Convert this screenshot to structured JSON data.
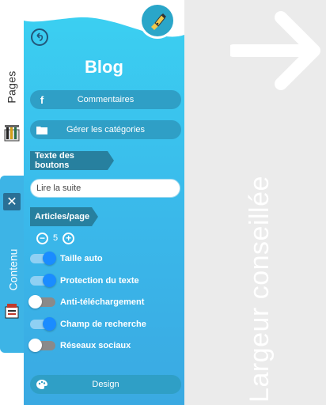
{
  "sidebar": {
    "tabs": {
      "pages": "Pages",
      "contenu": "Contenu"
    }
  },
  "panel": {
    "title": "Blog",
    "buttons": {
      "commentaires": "Commentaires",
      "categories": "Gérer les catégories",
      "design": "Design"
    },
    "sections": {
      "texte_boutons": "Texte des boutons",
      "articles_page": "Articles/page"
    },
    "read_more_input": {
      "value": "Lire la suite"
    },
    "stepper": {
      "value": "5"
    },
    "toggles": [
      {
        "label": "Taille auto",
        "on": true
      },
      {
        "label": "Protection du texte",
        "on": true
      },
      {
        "label": "Anti-téléchargement",
        "on": false
      },
      {
        "label": "Champ de recherche",
        "on": true
      },
      {
        "label": "Réseaux sociaux",
        "on": false
      }
    ]
  },
  "preview": {
    "label": "Largeur conseillée"
  },
  "colors": {
    "accent": "#3ab8ea",
    "dark_tag": "#27809f",
    "button": "#2f9fc6",
    "toggle_on": "#1a8cff"
  },
  "icons": {
    "facebook": "facebook-icon",
    "folder": "folder-icon",
    "palette": "palette-icon",
    "back": "back-icon",
    "logo": "pen-logo-icon"
  }
}
